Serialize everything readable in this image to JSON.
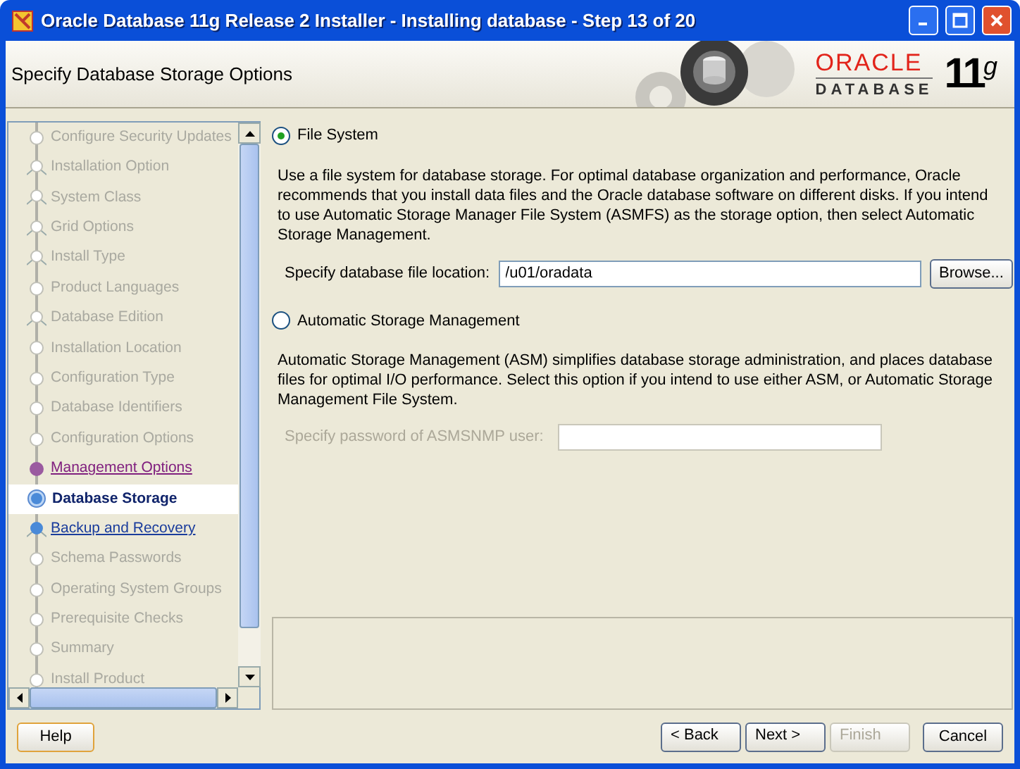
{
  "window": {
    "title": "Oracle Database 11g Release 2 Installer - Installing database - Step 13 of 20"
  },
  "header": {
    "title": "Specify Database Storage Options",
    "logo": {
      "brand": "ORACLE",
      "product": "DATABASE",
      "version": "11$^{g}$"
    }
  },
  "steps": [
    {
      "label": "Configure Security Updates",
      "kind": "node",
      "disabled": true,
      "visited": false,
      "selected": false
    },
    {
      "label": "Installation Option",
      "kind": "branch",
      "disabled": true,
      "visited": false,
      "selected": false
    },
    {
      "label": "System Class",
      "kind": "branch",
      "disabled": true,
      "visited": false,
      "selected": false
    },
    {
      "label": "Grid Options",
      "kind": "branch",
      "disabled": true,
      "visited": false,
      "selected": false
    },
    {
      "label": "Install Type",
      "kind": "branch",
      "disabled": true,
      "visited": false,
      "selected": false
    },
    {
      "label": "Product Languages",
      "kind": "node",
      "disabled": true,
      "visited": false,
      "selected": false
    },
    {
      "label": "Database Edition",
      "kind": "branch",
      "disabled": true,
      "visited": false,
      "selected": false
    },
    {
      "label": "Installation Location",
      "kind": "node",
      "disabled": true,
      "visited": false,
      "selected": false
    },
    {
      "label": "Configuration Type",
      "kind": "node",
      "disabled": true,
      "visited": false,
      "selected": false
    },
    {
      "label": "Database Identifiers",
      "kind": "node",
      "disabled": true,
      "visited": false,
      "selected": false
    },
    {
      "label": "Configuration Options",
      "kind": "node",
      "disabled": true,
      "visited": false,
      "selected": false
    },
    {
      "label": "Management Options",
      "kind": "node",
      "disabled": false,
      "visited": true,
      "selected": false
    },
    {
      "label": "Database Storage",
      "kind": "node",
      "disabled": false,
      "visited": false,
      "selected": true
    },
    {
      "label": "Backup and Recovery",
      "kind": "branch",
      "disabled": false,
      "visited": false,
      "selected": false
    },
    {
      "label": "Schema Passwords",
      "kind": "node",
      "disabled": true,
      "visited": false,
      "selected": false
    },
    {
      "label": "Operating System Groups",
      "kind": "node",
      "disabled": true,
      "visited": false,
      "selected": false
    },
    {
      "label": "Prerequisite Checks",
      "kind": "node",
      "disabled": true,
      "visited": false,
      "selected": false
    },
    {
      "label": "Summary",
      "kind": "node",
      "disabled": true,
      "visited": false,
      "selected": false
    },
    {
      "label": "Install Product",
      "kind": "node",
      "disabled": true,
      "visited": false,
      "selected": false
    }
  ],
  "options": [
    {
      "label": "File System",
      "selected": true,
      "description": "Use a file system for database storage. For optimal database organization and performance, Oracle recommends that you install data files and the Oracle database software on different disks. If you intend to use Automatic Storage Manager File System (ASMFS) as the storage option, then select Automatic Storage Management.",
      "field": {
        "label": "Specify database file location:",
        "value": "/u01/oradata",
        "disabled": false,
        "button": "Browse..."
      }
    },
    {
      "label": "Automatic Storage Management",
      "selected": false,
      "description": "Automatic Storage Management (ASM) simplifies database storage administration, and places database files for optimal I/O performance. Select this option if you intend to use either ASM, or Automatic Storage Management File System.",
      "field": {
        "label": "Specify password of ASMSNMP user:",
        "disabled": true
      }
    }
  ],
  "buttons": [
    {
      "label": "Help",
      "kind": "help",
      "disabled": false
    },
    {
      "label": "< Back",
      "kind": "nav",
      "disabled": false
    },
    {
      "label": "Next >",
      "kind": "nav",
      "disabled": false
    },
    {
      "label": "Finish",
      "kind": "nav",
      "disabled": true
    },
    {
      "label": "Cancel",
      "kind": "cancel",
      "disabled": false
    }
  ]
}
